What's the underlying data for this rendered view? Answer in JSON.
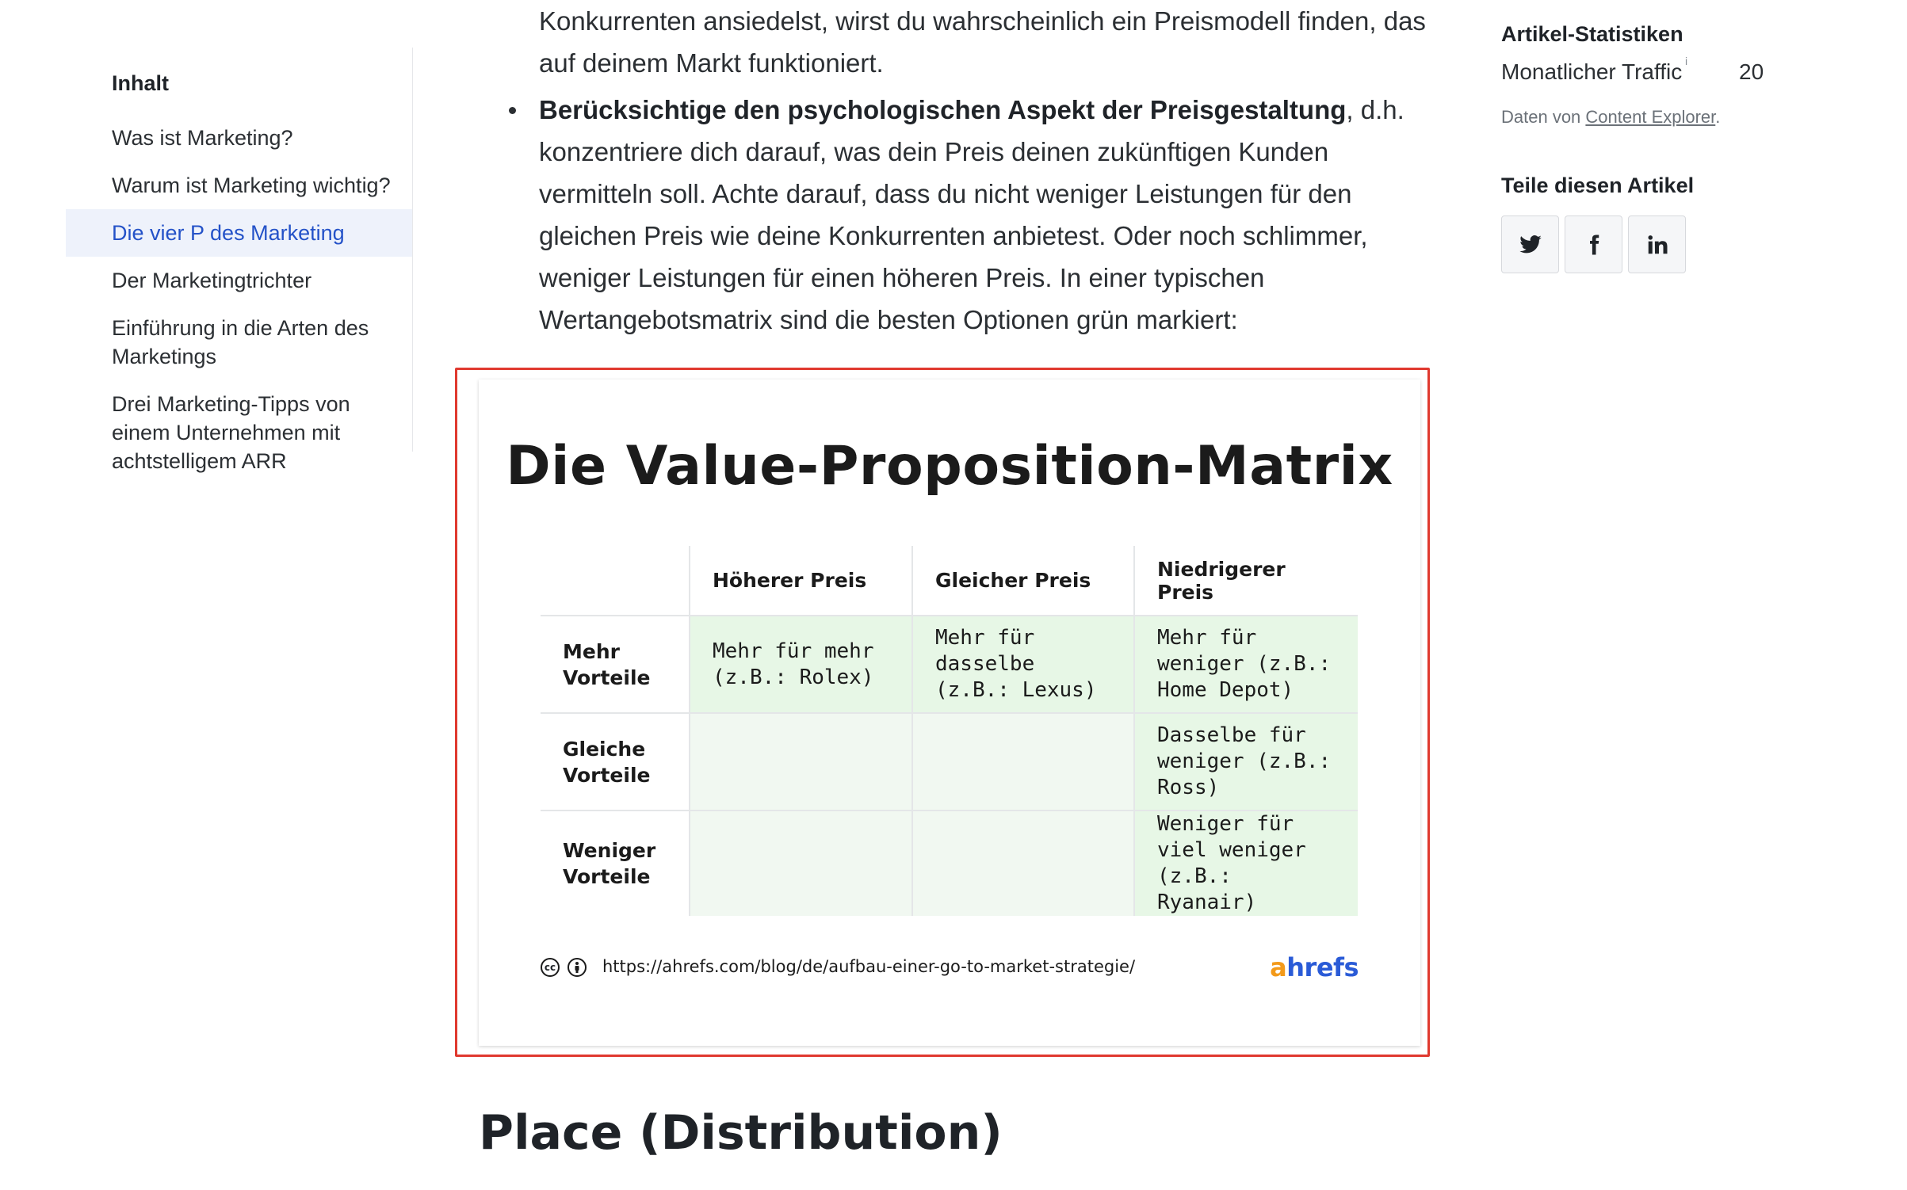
{
  "toc": {
    "title": "Inhalt",
    "items": [
      {
        "label": "Was ist Marketing?"
      },
      {
        "label": "Warum ist Marketing wichtig?"
      },
      {
        "label": "Die vier P des Marketing"
      },
      {
        "label": "Der Marketingtrichter"
      },
      {
        "label": "Einführung in die Arten des Marketings"
      },
      {
        "label": "Drei Marketing-Tipps von einem Unternehmen mit achtstelligem ARR"
      }
    ],
    "active_index": 2
  },
  "article": {
    "lead_text": "Konkurrenten ansiedelst, wirst du wahrscheinlich ein Preismodell finden, das auf deinem Markt funktioniert.",
    "bullet_bold": "Berücksichtige den psychologischen Aspekt der Preisgestaltung",
    "bullet_text": ", d.h. konzentriere dich darauf, was dein Preis deinen zukünftigen Kunden vermitteln soll. Achte darauf, dass du nicht weniger Leistungen für den gleichen Preis wie deine Konkurrenten anbietest. Oder noch schlimmer, weniger Leistungen für einen höheren Preis. In einer typischen Wertangebotsmatrix sind die besten Optionen grün markiert:",
    "next_heading": "Place (Distribution)"
  },
  "figure": {
    "title": "Die Value-Proposition-Matrix",
    "columns": [
      "Höherer Preis",
      "Gleicher Preis",
      "Niedrigerer Preis"
    ],
    "rows": [
      {
        "label": "Mehr Vorteile",
        "cells": [
          "Mehr für mehr (z.B.: Rolex)",
          "Mehr für dasselbe (z.B.: Lexus)",
          "Mehr für weniger (z.B.: Home Depot)"
        ]
      },
      {
        "label": "Gleiche Vorteile",
        "cells": [
          "",
          "",
          "Dasselbe für weniger (z.B.: Ross)"
        ]
      },
      {
        "label": "Weniger Vorteile",
        "cells": [
          "",
          "",
          "Weniger für viel weniger (z.B.: Ryanair)"
        ]
      }
    ],
    "url": "https://ahrefs.com/blog/de/aufbau-einer-go-to-market-strategie/",
    "brand_a": "a",
    "brand_rest": "hrefs",
    "icons": [
      "cc-icon",
      "attribution-icon"
    ],
    "colors": {
      "frame": "#e0392f",
      "green_cell": "#e7f7e6",
      "pale_cell": "#f1f8f1",
      "brand_blue": "#2a5bd7",
      "brand_orange": "#f39a1a"
    }
  },
  "sidebar": {
    "stats_title": "Artikel-Statistiken",
    "traffic_label": "Monatlicher Traffic",
    "traffic_info": "i",
    "traffic_value": "20",
    "data_prefix": "Daten von ",
    "data_link": "Content Explorer",
    "data_suffix": ".",
    "share_title": "Teile diesen Artikel",
    "share_buttons": [
      "twitter-icon",
      "facebook-icon",
      "linkedin-icon"
    ]
  },
  "colors": {
    "active_link": "#2452c8",
    "active_bg": "#eef2fb"
  }
}
